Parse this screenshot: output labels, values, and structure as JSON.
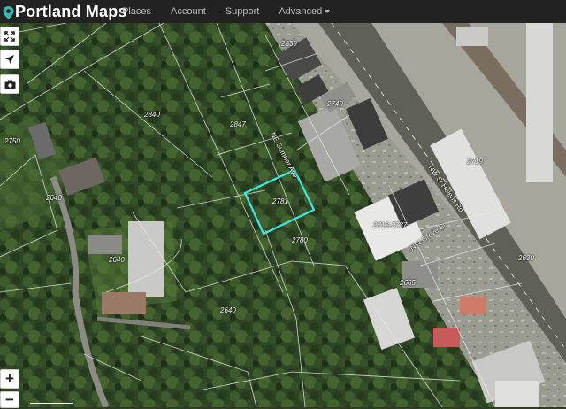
{
  "header": {
    "logo_text": "Portland Maps",
    "nav": {
      "places": "Places",
      "account": "Account",
      "support": "Support",
      "advanced": "Advanced"
    }
  },
  "map": {
    "selected_parcel": "2781",
    "parcel_labels": {
      "p2840": "2840",
      "p2847": "2847",
      "p2781": "2781",
      "p2780": "2780",
      "p2750": "2750",
      "p2640a": "2640",
      "p2640b": "2640",
      "p2640c": "2640",
      "p2839": "2839",
      "p2719": "2719",
      "p2740": "2740",
      "p2713": "2713-2737",
      "p2630": "2630",
      "p2665": "2665"
    },
    "street_labels": {
      "ne_sumner": "NE Sumner Ave",
      "nw_st_helens": "NW St Helens Rd",
      "nw_grove": "NW Grove St"
    },
    "colors": {
      "selected_outline": "#3ee8e0",
      "parcel_lines": "#e8e8e8"
    }
  },
  "controls": {
    "fullscreen_icon": "expand-icon",
    "locate_icon": "location-arrow-icon",
    "camera_icon": "camera-icon",
    "zoom_in": "+",
    "zoom_out": "−"
  }
}
